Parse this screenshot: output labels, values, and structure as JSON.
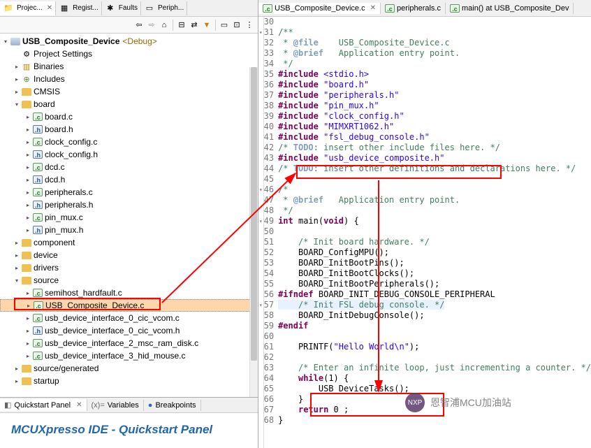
{
  "left_tabs": [
    {
      "label": "Projec...",
      "icon": "📁",
      "active": true
    },
    {
      "label": "Regist...",
      "icon": "▦"
    },
    {
      "label": "Faults",
      "icon": "✱"
    },
    {
      "label": "Periph...",
      "icon": "▭"
    }
  ],
  "project_name": "USB_Composite_Device",
  "project_config": "<Debug>",
  "tree": [
    {
      "depth": 1,
      "expand": "",
      "iconType": "gear",
      "label": "Project Settings"
    },
    {
      "depth": 1,
      "expand": "▸",
      "iconType": "bin",
      "label": "Binaries"
    },
    {
      "depth": 1,
      "expand": "▸",
      "iconType": "inc",
      "label": "Includes"
    },
    {
      "depth": 1,
      "expand": "▸",
      "iconType": "folder",
      "label": "CMSIS"
    },
    {
      "depth": 1,
      "expand": "▾",
      "iconType": "folder",
      "label": "board"
    },
    {
      "depth": 2,
      "expand": "▸",
      "iconType": "c",
      "label": "board.c"
    },
    {
      "depth": 2,
      "expand": "▸",
      "iconType": "h",
      "label": "board.h"
    },
    {
      "depth": 2,
      "expand": "▸",
      "iconType": "c",
      "label": "clock_config.c"
    },
    {
      "depth": 2,
      "expand": "▸",
      "iconType": "h",
      "label": "clock_config.h"
    },
    {
      "depth": 2,
      "expand": "▸",
      "iconType": "c",
      "label": "dcd.c"
    },
    {
      "depth": 2,
      "expand": "▸",
      "iconType": "h",
      "label": "dcd.h"
    },
    {
      "depth": 2,
      "expand": "▸",
      "iconType": "c",
      "label": "peripherals.c"
    },
    {
      "depth": 2,
      "expand": "▸",
      "iconType": "h",
      "label": "peripherals.h"
    },
    {
      "depth": 2,
      "expand": "▸",
      "iconType": "c",
      "label": "pin_mux.c"
    },
    {
      "depth": 2,
      "expand": "▸",
      "iconType": "h",
      "label": "pin_mux.h"
    },
    {
      "depth": 1,
      "expand": "▸",
      "iconType": "folder",
      "label": "component"
    },
    {
      "depth": 1,
      "expand": "▸",
      "iconType": "folder",
      "label": "device"
    },
    {
      "depth": 1,
      "expand": "▸",
      "iconType": "folder",
      "label": "drivers"
    },
    {
      "depth": 1,
      "expand": "▾",
      "iconType": "folder",
      "label": "source"
    },
    {
      "depth": 2,
      "expand": "▸",
      "iconType": "c",
      "label": "semihost_hardfault.c"
    },
    {
      "depth": 2,
      "expand": "▸",
      "iconType": "c",
      "label": "USB_Composite_Device.c",
      "selected": true
    },
    {
      "depth": 2,
      "expand": "▸",
      "iconType": "c",
      "label": "usb_device_interface_0_cic_vcom.c"
    },
    {
      "depth": 2,
      "expand": "▸",
      "iconType": "h",
      "label": "usb_device_interface_0_cic_vcom.h"
    },
    {
      "depth": 2,
      "expand": "▸",
      "iconType": "c",
      "label": "usb_device_interface_2_msc_ram_disk.c"
    },
    {
      "depth": 2,
      "expand": "▸",
      "iconType": "c",
      "label": "usb_device_interface_3_hid_mouse.c"
    },
    {
      "depth": 1,
      "expand": "▸",
      "iconType": "folder",
      "label": "source/generated"
    },
    {
      "depth": 1,
      "expand": "▸",
      "iconType": "folder",
      "label": "startup"
    }
  ],
  "bottom_left_tabs": [
    {
      "label": "Quickstart Panel",
      "icon": "◧",
      "active": true
    },
    {
      "label": "Variables",
      "icon": "(x)="
    },
    {
      "label": "Breakpoints",
      "icon": "●"
    }
  ],
  "quickstart_title": "MCUXpresso IDE - Quickstart Panel",
  "right_tabs": [
    {
      "label": "USB_Composite_Device.c",
      "icon": "c",
      "active": true
    },
    {
      "label": "peripherals.c",
      "icon": "c"
    },
    {
      "label": "main() at USB_Composite_Dev",
      "icon": "c"
    }
  ],
  "code_start_line": 30,
  "code_lines": [
    {
      "t": "",
      "fold": ""
    },
    {
      "t": "/**",
      "cls": "cmt",
      "fold": "▾"
    },
    {
      "html": "<span class='cmt'> * </span><span class='doctag'>@file</span><span class='cmt'>    USB_Composite_Device.c</span>"
    },
    {
      "html": "<span class='cmt'> * </span><span class='doctag'>@brief</span><span class='cmt'>   Application entry point.</span>"
    },
    {
      "t": " */",
      "cls": "cmt"
    },
    {
      "html": "<span class='kw'>#include</span> <span class='str'>&lt;stdio.h&gt;</span>"
    },
    {
      "html": "<span class='kw'>#include</span> <span class='str'>\"board.h\"</span>"
    },
    {
      "html": "<span class='kw'>#include</span> <span class='str'>\"peripherals.h\"</span>"
    },
    {
      "html": "<span class='kw'>#include</span> <span class='str'>\"pin_mux.h\"</span>"
    },
    {
      "html": "<span class='kw'>#include</span> <span class='str'>\"clock_config.h\"</span>"
    },
    {
      "html": "<span class='kw'>#include</span> <span class='str'>\"MIMXRT1062.h\"</span>"
    },
    {
      "html": "<span class='kw'>#include</span> <span class='str'>\"fsl_debug_console.h\"</span>"
    },
    {
      "html": "<span class='cmt'>/* </span><span class='todo'>TODO</span><span class='cmt'>: insert other include files here. */</span>"
    },
    {
      "html": "<span class='kw'>#include</span> <span class='str'>\"usb_device_composite.h\"</span>"
    },
    {
      "html": "<span class='cmt'>/* </span><span class='todo'>TODO</span><span class='cmt'>: insert other definitions and declarations here. */</span>"
    },
    {
      "t": ""
    },
    {
      "t": "/*",
      "cls": "cmt",
      "fold": "▾"
    },
    {
      "html": "<span class='cmt'> * </span><span class='doctag'>@brief</span><span class='cmt'>   Application entry point.</span>"
    },
    {
      "t": " */",
      "cls": "cmt"
    },
    {
      "html": "<span class='kw'>int</span> main(<span class='kw'>void</span>) {",
      "fold": "▾"
    },
    {
      "t": ""
    },
    {
      "t": "    /* Init board hardware. */",
      "cls": "cmt"
    },
    {
      "t": "    BOARD_ConfigMPU();"
    },
    {
      "t": "    BOARD_InitBootPins();"
    },
    {
      "t": "    BOARD_InitBootClocks();"
    },
    {
      "t": "    BOARD_InitBootPeripherals();"
    },
    {
      "html": "<span class='kw'>#ifndef</span> BOARD_INIT_DEBUG_CONSOLE_PERIPHERAL"
    },
    {
      "html": "<span class='caret-line'>    <span class='cmt'>/* Init FSL debug console. */</span></span>",
      "fold": "▾"
    },
    {
      "t": "    BOARD_InitDebugConsole();"
    },
    {
      "html": "<span class='kw'>#endif</span>"
    },
    {
      "t": ""
    },
    {
      "html": "    PRINTF(<span class='str'>\"Hello World\\n\"</span>);"
    },
    {
      "t": ""
    },
    {
      "t": "    /* Enter an infinite loop, just incrementing a counter. */",
      "cls": "cmt"
    },
    {
      "html": "    <span class='kw'>while</span>(1) {"
    },
    {
      "t": "        USB_DeviceTasks();"
    },
    {
      "t": "    }"
    },
    {
      "html": "    <span class='kw'>return</span> 0 ;"
    },
    {
      "t": "}"
    }
  ],
  "watermark_text": "恩智浦MCU加油站"
}
